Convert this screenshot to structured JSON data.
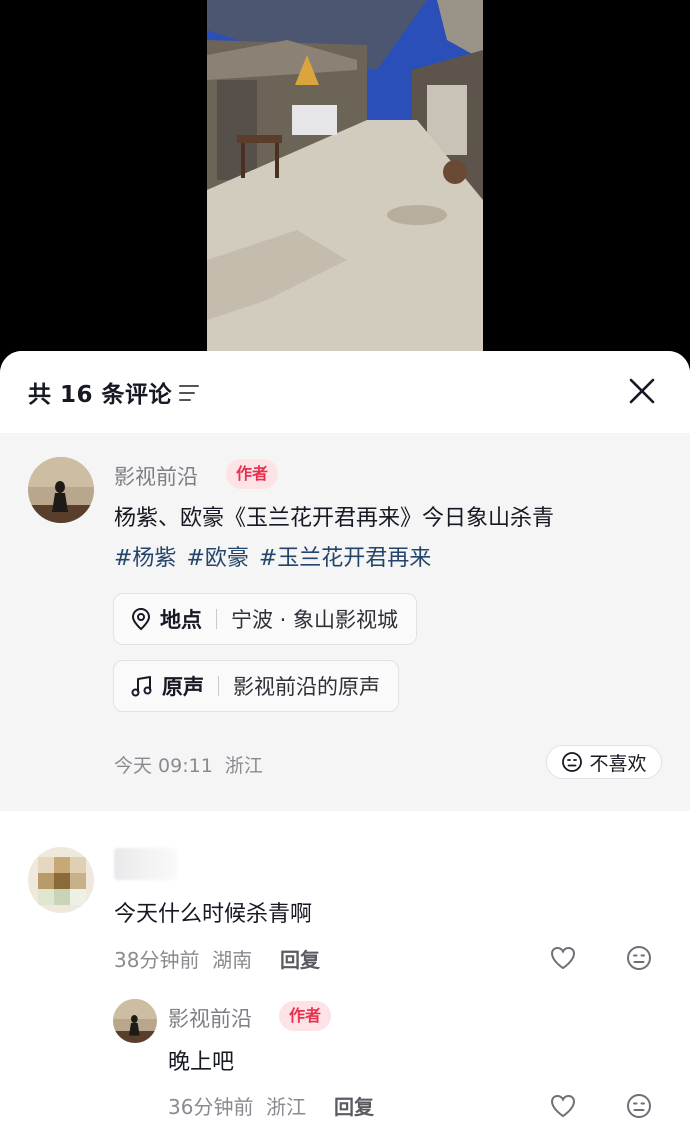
{
  "comments_sheet": {
    "count_label": "共 16 条评论"
  },
  "post": {
    "author_name": "影视前沿",
    "author_badge": "作者",
    "text": "杨紫、欧豪《玉兰花开君再来》今日象山杀青",
    "hashtags": [
      "#杨紫",
      "#欧豪",
      "#玉兰花开君再来"
    ],
    "location_label": "地点",
    "location_value": "宁波 · 象山影视城",
    "sound_label": "原声",
    "sound_value": "影视前沿的原声",
    "time": "今天 09:11",
    "region": "浙江",
    "dislike_label": "不喜欢"
  },
  "comments": [
    {
      "text": "今天什么时候杀青啊",
      "time": "38分钟前",
      "region": "湖南",
      "reply_label": "回复",
      "replies": [
        {
          "author_name": "影视前沿",
          "author_badge": "作者",
          "text": "晚上吧",
          "time": "36分钟前",
          "region": "浙江",
          "reply_label": "回复"
        }
      ]
    }
  ],
  "colors": {
    "badge_bg": "#fde3e6",
    "badge_text": "#e8304f",
    "hashtag": "#24456b",
    "post_bg": "#f5f5f6"
  }
}
